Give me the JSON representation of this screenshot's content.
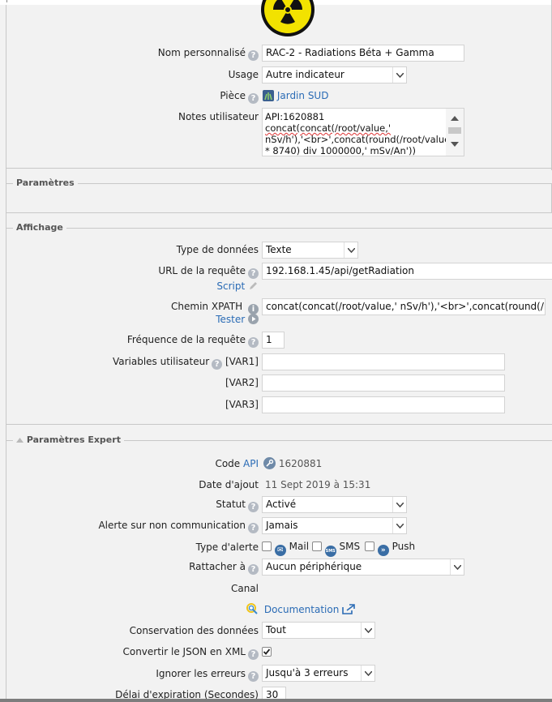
{
  "device": {
    "custom_name_label": "Nom personnalisé",
    "custom_name_value": "RAC-2 - Radiations Béta + Gamma",
    "usage_label": "Usage",
    "usage_value": "Autre indicateur",
    "room_label": "Pièce",
    "room_value": "Jardin SUD",
    "notes_label": "Notes utilisateur",
    "notes_lines": [
      "API:1620881",
      "concat(concat(/root/value,'",
      "nSv/h'),'<br>',concat(round(/root/value",
      "* 8740) div 1000000,' mSv/An'))"
    ]
  },
  "sections": {
    "parametres": "Paramètres",
    "affichage": "Affichage",
    "expert": "Paramètres Expert"
  },
  "affichage": {
    "data_type_label": "Type de données",
    "data_type_value": "Texte",
    "url_label": "URL de la requête",
    "url_value": "192.168.1.45/api/getRadiation",
    "script_link": "Script",
    "xpath_label": "Chemin XPATH",
    "xpath_value": "concat(concat(/root/value,' nSv/h'),'<br>',concat(round(/root/va",
    "test_link": "Tester",
    "freq_label": "Fréquence de la requête",
    "freq_value": "1",
    "vars_label": "Variables utilisateur",
    "var1": "[VAR1]",
    "var2": "[VAR2]",
    "var3": "[VAR3]"
  },
  "expert": {
    "code_label": "Code",
    "code_api_link": "API",
    "code_value": "1620881",
    "date_label": "Date d'ajout",
    "date_value": "11 Sept 2019 à 15:31",
    "status_label": "Statut",
    "status_value": "Activé",
    "alert_nocomm_label": "Alerte sur non communication",
    "alert_nocomm_value": "Jamais",
    "alert_type_label": "Type d'alerte",
    "alert_mail": "Mail",
    "alert_sms": "SMS",
    "alert_push": "Push",
    "attach_label": "Rattacher à",
    "attach_value": "Aucun périphérique",
    "channel_label": "Canal",
    "doc_link": "Documentation",
    "retention_label": "Conservation des données",
    "retention_value": "Tout",
    "json_xml_label": "Convertir le JSON en XML",
    "ignore_errors_label": "Ignorer les erreurs",
    "ignore_errors_value": "Jusqu'à 3 erreurs",
    "timeout_label": "Délai d'expiration (Secondes)",
    "timeout_value": "30"
  },
  "icons": {
    "help": "?",
    "sms_badge": "SMS",
    "push_badge": "»"
  },
  "colors": {
    "link": "#2a6bb5",
    "radiation_yellow": "#f2e200"
  }
}
